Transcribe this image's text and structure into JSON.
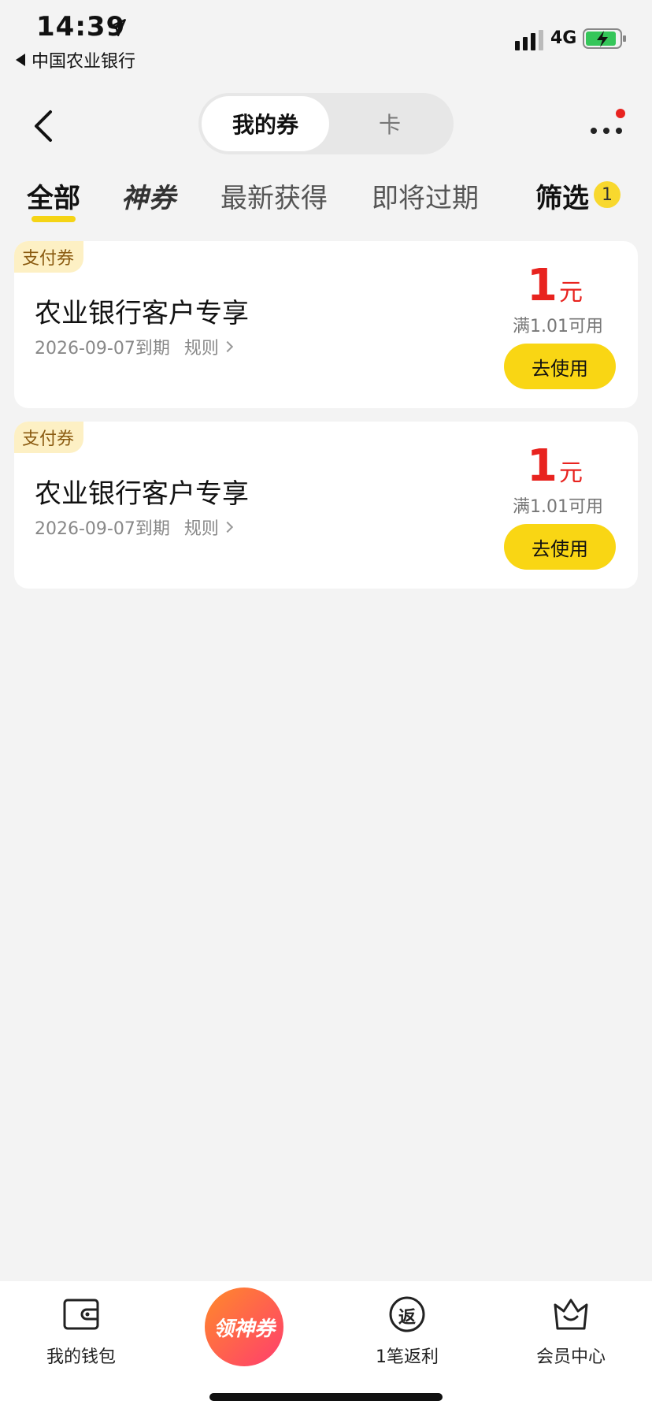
{
  "status_bar": {
    "time": "14:39",
    "back_app": "中国农业银行",
    "network": "4G"
  },
  "nav": {
    "segments": [
      "我的券",
      "卡"
    ],
    "active_segment": "我的券"
  },
  "tabs": {
    "items": [
      "全部",
      "神券",
      "最新获得",
      "即将过期",
      "筛选"
    ],
    "active": "全部",
    "filter_badge": "1"
  },
  "coupons": [
    {
      "tag": "支付券",
      "title": "农业银行客户专享",
      "expiry": "2026-09-07到期",
      "rule_label": "规则",
      "amount": "1",
      "unit": "元",
      "condition": "满1.01可用",
      "button": "去使用"
    },
    {
      "tag": "支付券",
      "title": "农业银行客户专享",
      "expiry": "2026-09-07到期",
      "rule_label": "规则",
      "amount": "1",
      "unit": "元",
      "condition": "满1.01可用",
      "button": "去使用"
    }
  ],
  "bottom_nav": {
    "wallet": "我的钱包",
    "center": "领神券",
    "rebate": "1笔返利",
    "rebate_icon_char": "返",
    "member": "会员中心"
  },
  "colors": {
    "accent_yellow": "#f9d614",
    "price_red": "#e8231f",
    "tag_bg": "#fdf0c4"
  }
}
